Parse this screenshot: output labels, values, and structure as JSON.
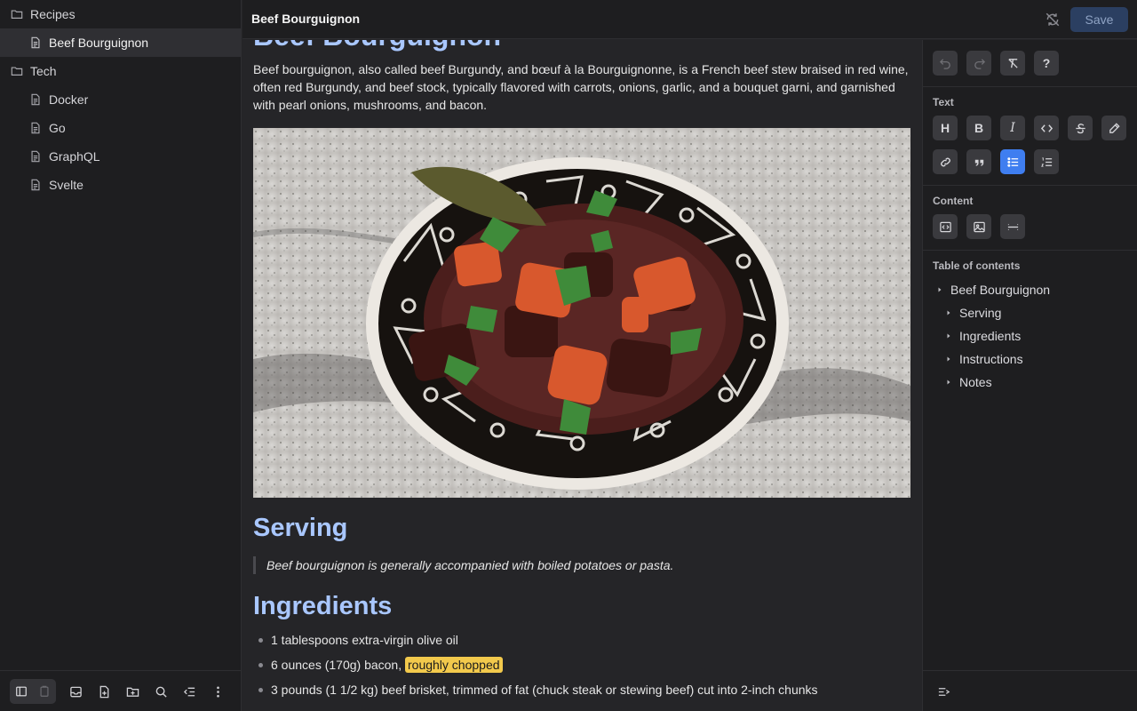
{
  "sidebar": {
    "folders": [
      {
        "label": "Recipes",
        "icon": "folder-icon"
      },
      {
        "label": "Tech",
        "icon": "folder-icon"
      }
    ],
    "notes": [
      {
        "label": "Beef Bourguignon",
        "icon": "document-icon",
        "active": true
      },
      {
        "label": "Docker",
        "icon": "document-icon"
      },
      {
        "label": "Go",
        "icon": "document-icon"
      },
      {
        "label": "GraphQL",
        "icon": "document-icon"
      },
      {
        "label": "Svelte",
        "icon": "document-icon"
      }
    ],
    "footer_icons": [
      "sidebar-layout-icon",
      "clipboard-icon",
      "inbox-icon",
      "new-note-icon",
      "new-folder-icon",
      "search-icon",
      "collapse-list-icon",
      "more-vertical-icon"
    ]
  },
  "header": {
    "title": "Beef Bourguignon",
    "sync_icon": "sync-off-icon",
    "save_label": "Save"
  },
  "document": {
    "title": "Beef Bourguignon",
    "intro": "Beef bourguignon, also called beef Burgundy, and bœuf à la Bourguignonne, is a French beef stew braised in red wine, often red Burgundy, and beef stock, typically flavored with carrots, onions, garlic, and a bouquet garni, and garnished with pearl onions, mushrooms, and bacon.",
    "serving_heading": "Serving",
    "serving_quote": "Beef bourguignon is generally accompanied with boiled potatoes or pasta.",
    "ingredients_heading": "Ingredients",
    "ingredients": [
      {
        "text": "1 tablespoons extra-virgin olive oil"
      },
      {
        "text": "6 ounces (170g) bacon, ",
        "highlight": "roughly chopped"
      },
      {
        "text": "3 pounds (1 1/2 kg) beef brisket, trimmed of fat (chuck steak or stewing beef) cut into 2-inch chunks"
      }
    ]
  },
  "panel": {
    "history_icons": [
      "undo-icon",
      "redo-icon",
      "clear-format-icon",
      "help-icon"
    ],
    "text_label": "Text",
    "text_icons": [
      "heading-icon",
      "bold-icon",
      "italic-icon",
      "code-icon",
      "strikethrough-icon",
      "highlight-pen-icon",
      "link-icon",
      "quote-icon",
      "bullet-list-icon",
      "ordered-list-icon"
    ],
    "content_label": "Content",
    "content_icons": [
      "code-block-icon",
      "image-icon",
      "horizontal-rule-icon"
    ],
    "toc_label": "Table of contents",
    "toc": [
      "Beef Bourguignon",
      "Serving",
      "Ingredients",
      "Instructions",
      "Notes"
    ],
    "footer_icon": "toc-toggle-icon"
  },
  "colors": {
    "heading": "#a9c7ff",
    "accent": "#3f7ef0",
    "highlight": "#f2c94c",
    "save_button": "#2b3f61"
  }
}
